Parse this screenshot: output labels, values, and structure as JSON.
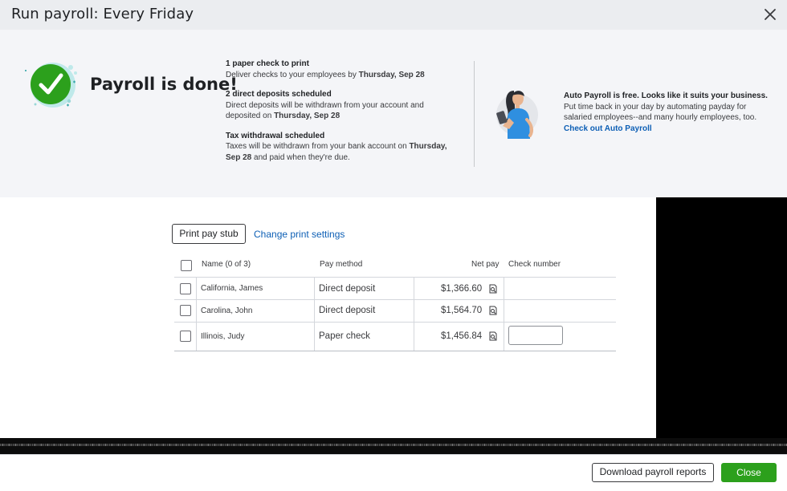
{
  "header": {
    "title": "Run payroll: Every Friday"
  },
  "banner": {
    "headline": "Payroll is done!",
    "steps": [
      {
        "title": "1 paper check to print",
        "text_pre": "Deliver checks to your employees by ",
        "text_bold": "Thursday, Sep 28",
        "text_post": ""
      },
      {
        "title": "2 direct deposits scheduled",
        "text_pre": "Direct deposits will be withdrawn from your account and deposited on ",
        "text_bold": "Thursday, Sep 28",
        "text_post": ""
      },
      {
        "title": "Tax withdrawal scheduled",
        "text_pre": "Taxes will be withdrawn from your bank account on ",
        "text_bold": "Thursday, Sep 28",
        "text_post": " and paid when they're due."
      }
    ],
    "promo": {
      "title": "Auto Payroll is free. Looks like it suits your business.",
      "text": "Put time back in your day by automating payday for salaried employees--and many hourly employees, too.",
      "link": "Check out Auto Payroll"
    }
  },
  "actions": {
    "print_label": "Print pay stub",
    "settings_label": "Change print settings"
  },
  "table": {
    "headers": {
      "name": "Name (0 of 3)",
      "method": "Pay method",
      "net": "Net pay",
      "check": "Check number"
    },
    "rows": [
      {
        "name": "California, James",
        "method": "Direct deposit",
        "net": "$1,366.60"
      },
      {
        "name": "Carolina, John",
        "method": "Direct deposit",
        "net": "$1,564.70"
      },
      {
        "name": "Illinois, Judy",
        "method": "Paper check",
        "net": "$1,456.84"
      }
    ]
  },
  "footer": {
    "download_label": "Download payroll reports",
    "close_label": "Close"
  },
  "colors": {
    "accent_green": "#2ca01c",
    "link_blue": "#0d5fb5",
    "check_green": "#2ca01c"
  },
  "icons": {
    "close": "close-icon",
    "success": "checkmark-circle-icon",
    "magnifier": "paystub-preview-icon"
  }
}
